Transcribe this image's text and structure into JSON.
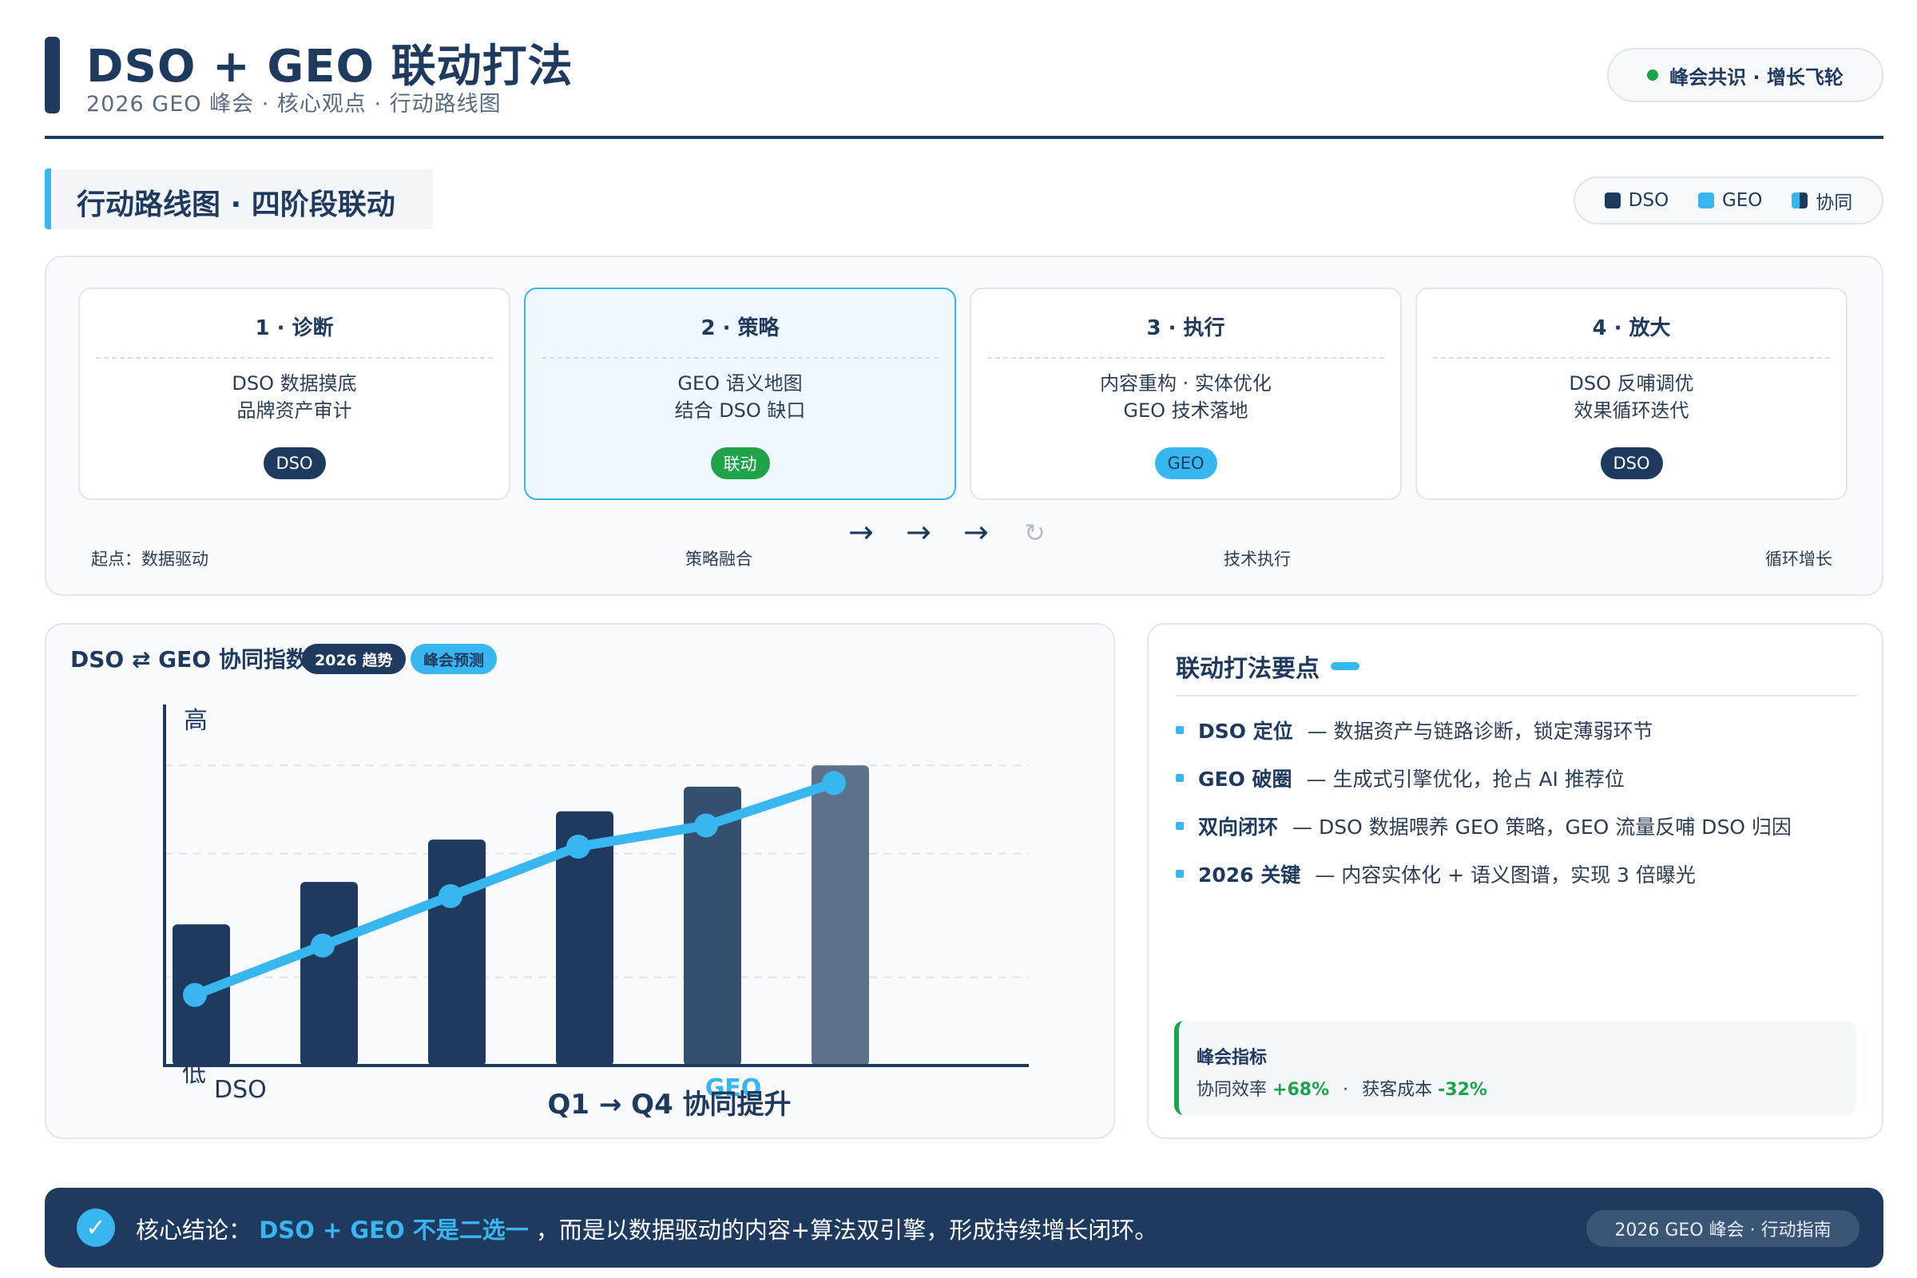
{
  "header": {
    "title": "DSO + GEO 联动打法",
    "subtitle": "2026 GEO 峰会 · 核心观点 · 行动路线图",
    "badge": "峰会共识 · 增长飞轮"
  },
  "section": {
    "title": "行动路线图 · 四阶段联动"
  },
  "legend": [
    {
      "label": "DSO",
      "color": "#1f3a5f"
    },
    {
      "label": "GEO",
      "color": "#38b6f0"
    },
    {
      "label": "协同",
      "color": "#38b6f0"
    }
  ],
  "roadmap": {
    "stages": [
      {
        "title": "1 · 诊断",
        "line1": "DSO 数据摸底",
        "line2": "品牌资产审计",
        "tag": "DSO"
      },
      {
        "title": "2 · 策略",
        "line1": "GEO 语义地图",
        "line2": "结合 DSO 缺口",
        "tag": "联动"
      },
      {
        "title": "3 · 执行",
        "line1": "内容重构 · 实体优化",
        "line2": "GEO 技术落地",
        "tag": "GEO"
      },
      {
        "title": "4 · 放大",
        "line1": "DSO 反哺调优",
        "line2": "效果循环迭代",
        "tag": "DSO"
      }
    ],
    "flow_arrows": [
      "→",
      "→",
      "→"
    ],
    "loop_icon": "↻",
    "labels": [
      "起点：数据驱动",
      "策略融合",
      "技术执行",
      "循环增长"
    ]
  },
  "chart": {
    "title": "DSO ⇄ GEO 协同指数",
    "tag1": "2026 趋势",
    "tag2": "峰会预测"
  },
  "chart_data": {
    "type": "bar",
    "title": "DSO ⇄ GEO 协同指数",
    "categories": [
      "",
      "",
      "",
      "",
      "",
      ""
    ],
    "series": [
      {
        "values": [
          40,
          52,
          64,
          72,
          79,
          85
        ]
      },
      {
        "values": [
          20,
          34,
          48,
          62,
          68,
          80
        ]
      }
    ],
    "y_top_label": "高",
    "y_bottom_label": "低",
    "x_start_label": "DSO",
    "x_mid_label": "GEO",
    "xlabel": "Q1 → Q4 协同提升",
    "ylim": [
      0,
      100
    ],
    "grid": true,
    "bar_colors": [
      "#1f3a5f",
      "#1f3a5f",
      "#1f3a5f",
      "#1f3a5f",
      "#34506f",
      "#5d718b"
    ],
    "line_color": "#38b6f0"
  },
  "points": {
    "title": "联动打法要点",
    "items": [
      {
        "key": "DSO 定位",
        "text": "— 数据资产与链路诊断，锁定薄弱环节"
      },
      {
        "key": "GEO 破圈",
        "text": "— 生成式引擎优化，抢占 AI 推荐位"
      },
      {
        "key": "双向闭环",
        "text": "— DSO 数据喂养 GEO 策略，GEO 流量反哺 DSO 归因"
      },
      {
        "key": "2026 关键",
        "text": "— 内容实体化 + 语义图谱，实现 3 倍曝光"
      }
    ],
    "kpi": {
      "title": "峰会指标",
      "label1": "协同效率",
      "value1": "+68%",
      "sep": "·",
      "label2": "获客成本",
      "value2": "-32%"
    }
  },
  "footer": {
    "check_icon": "✓",
    "lead": "核心结论：",
    "highlight": "DSO + GEO 不是二选一",
    "rest": "，而是以数据驱动的内容+算法双引擎，形成持续增长闭环。",
    "badge": "2026 GEO 峰会 · 行动指南"
  }
}
